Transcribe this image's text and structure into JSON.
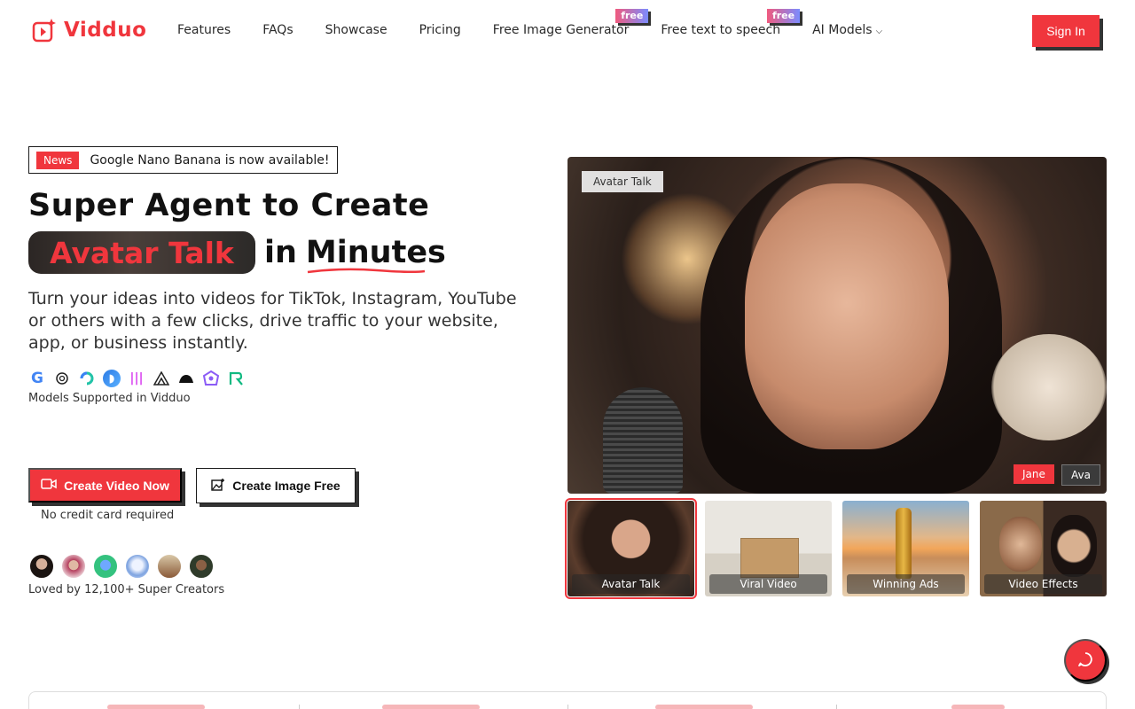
{
  "brand": {
    "name": "Vidduo",
    "accent": "#f0363d"
  },
  "nav": {
    "items": [
      {
        "label": "Features"
      },
      {
        "label": "FAQs"
      },
      {
        "label": "Showcase"
      },
      {
        "label": "Pricing"
      },
      {
        "label": "Free Image Generator",
        "badge": "free"
      },
      {
        "label": "Free text to speech",
        "badge": "free"
      },
      {
        "label": "AI Models",
        "chevron": "chevron-down-icon"
      }
    ],
    "signin": "Sign In"
  },
  "hero": {
    "news_badge": "News",
    "news_text": "Google Nano Banana is now available!",
    "title_line1": "Super Agent to Create",
    "title_pill": "Avatar Talk",
    "title_in": "in",
    "title_minutes": "Minutes",
    "subtitle": "Turn your ideas into videos for TikTok, Instagram, YouTube or others with a few clicks, drive traffic to your website, app, or business instantly.",
    "models_label": "Models Supported in Vidduo",
    "model_icons": [
      "google-icon",
      "openai-icon",
      "kling-icon",
      "hailuo-icon",
      "elevenlabs-icon",
      "luma-icon",
      "midjourney-icon",
      "flux-icon",
      "runway-icon"
    ],
    "cta_primary": "Create Video Now",
    "cta_secondary": "Create Image Free",
    "no_credit": "No credit card required",
    "loved": "Loved by 12,100+ Super Creators"
  },
  "preview": {
    "label": "Avatar Talk",
    "voices": [
      "Jane",
      "Ava"
    ],
    "thumbnails": [
      {
        "label": "Avatar Talk",
        "active": true
      },
      {
        "label": "Viral Video",
        "active": false
      },
      {
        "label": "Winning Ads",
        "active": false
      },
      {
        "label": "Video Effects",
        "active": false
      }
    ]
  }
}
